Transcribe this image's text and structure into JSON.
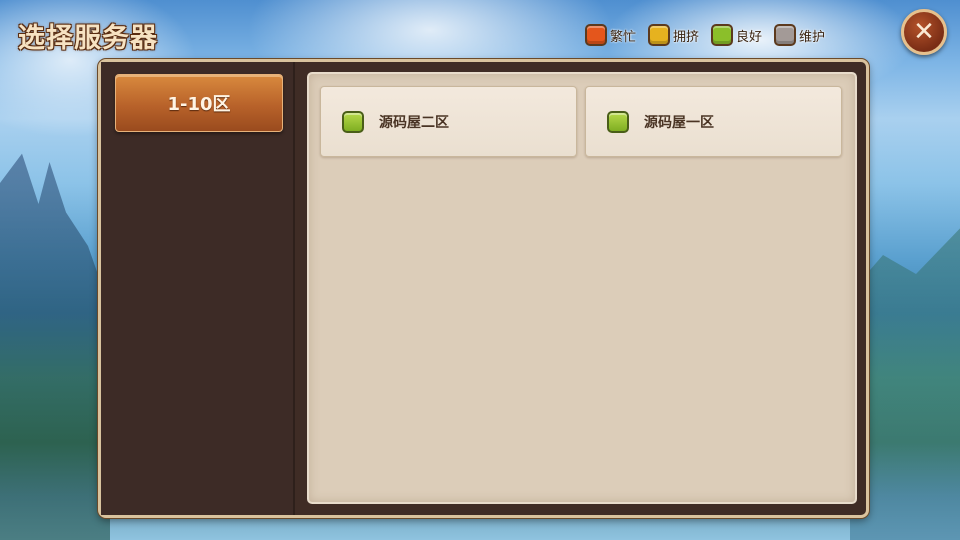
{
  "title": "选择服务器",
  "legend": [
    {
      "label": "繁忙",
      "color": "#e4561c"
    },
    {
      "label": "拥挤",
      "color": "#e6b21f"
    },
    {
      "label": "良好",
      "color": "#8bbf2a"
    },
    {
      "label": "维护",
      "color": "#a39a97"
    }
  ],
  "close_icon": "close-icon",
  "close_glyph": "✕",
  "sidebar": {
    "tabs": [
      {
        "label": "1-10区",
        "selected": true
      }
    ]
  },
  "servers": [
    {
      "name": "源码屋二区",
      "status": "良好",
      "status_color": "#8bbf2a"
    },
    {
      "name": "源码屋一区",
      "status": "良好",
      "status_color": "#8bbf2a"
    }
  ]
}
